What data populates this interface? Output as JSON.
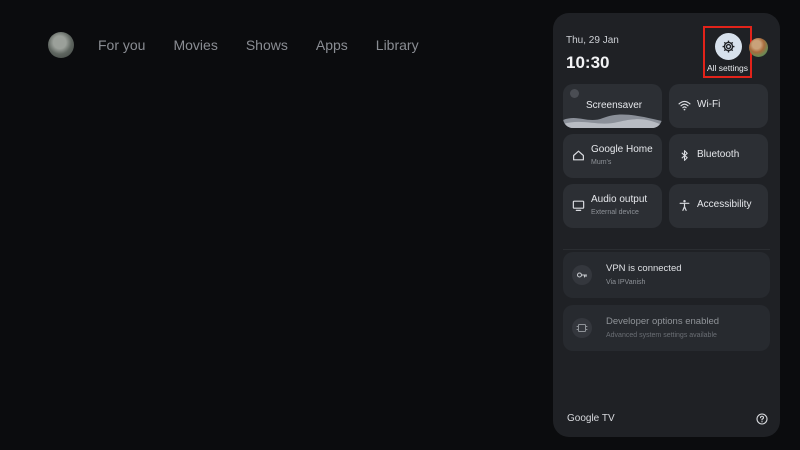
{
  "nav": {
    "items": [
      "For you",
      "Movies",
      "Shows",
      "Apps",
      "Library"
    ]
  },
  "panel": {
    "date": "Thu, 29 Jan",
    "time": "10:30",
    "all_settings_label": "All settings",
    "tiles": [
      {
        "title": "Screensaver",
        "subtitle": "",
        "icon": "screensaver-icon"
      },
      {
        "title": "Wi-Fi",
        "subtitle": "",
        "icon": "wifi-icon"
      },
      {
        "title": "Google Home",
        "subtitle": "Mum's",
        "icon": "home-icon"
      },
      {
        "title": "Bluetooth",
        "subtitle": "",
        "icon": "bluetooth-icon"
      },
      {
        "title": "Audio output",
        "subtitle": "External device",
        "icon": "tv-icon"
      },
      {
        "title": "Accessibility",
        "subtitle": "",
        "icon": "accessibility-icon"
      }
    ],
    "notices": [
      {
        "title": "VPN is connected",
        "subtitle": "Via IPVanish",
        "icon": "vpn-key-icon"
      },
      {
        "title": "Developer options enabled",
        "subtitle": "Advanced system settings available",
        "icon": "developer-icon"
      }
    ],
    "brand": "Google TV"
  },
  "colors": {
    "background": "#0b0c0e",
    "panel": "#1f2125",
    "tile": "#2c2f34",
    "highlight": "#e2231a",
    "gear_circle": "#d7e1ec"
  }
}
